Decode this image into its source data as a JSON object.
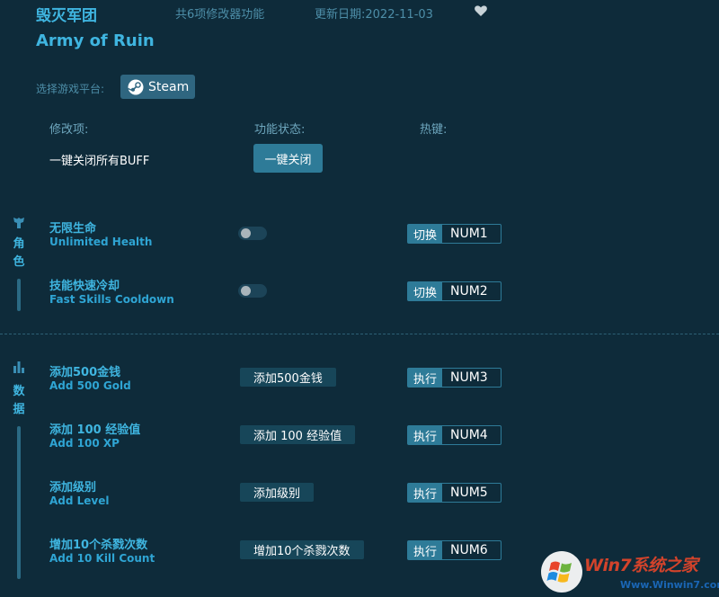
{
  "header": {
    "title_cn": "毁灭军团",
    "feature_count": "共6项修改器功能",
    "update_date": "更新日期:2022-11-03",
    "title_en": "Army of Ruin"
  },
  "platform": {
    "label": "选择游戏平台:",
    "button": "Steam"
  },
  "columns": {
    "mod": "修改项:",
    "status": "功能状态:",
    "hotkey": "热键:"
  },
  "global": {
    "label": "一键关闭所有BUFF",
    "button": "一键关闭"
  },
  "sections": {
    "character": {
      "line1": "角",
      "line2": "色"
    },
    "data": {
      "line1": "数",
      "line2": "据"
    }
  },
  "character_items": [
    {
      "cn": "无限生命",
      "en": "Unlimited Health",
      "toggle_on": false,
      "hk_type": "切换",
      "hk_key": "NUM1"
    },
    {
      "cn": "技能快速冷却",
      "en": "Fast Skills Cooldown",
      "toggle_on": false,
      "hk_type": "切换",
      "hk_key": "NUM2"
    }
  ],
  "data_items": [
    {
      "cn": "添加500金钱",
      "en": "Add 500 Gold",
      "button": "添加500金钱",
      "hk_type": "执行",
      "hk_key": "NUM3"
    },
    {
      "cn": "添加 100 经验值",
      "en": "Add 100 XP",
      "button": "添加 100 经验值",
      "hk_type": "执行",
      "hk_key": "NUM4"
    },
    {
      "cn": "添加级别",
      "en": "Add Level",
      "button": "添加级别",
      "hk_type": "执行",
      "hk_key": "NUM5"
    },
    {
      "cn": "增加10个杀戮次数",
      "en": "Add 10 Kill Count",
      "button": "增加10个杀戮次数",
      "hk_type": "执行",
      "hk_key": "NUM6"
    }
  ],
  "watermark": {
    "brand": "Win7系统之家",
    "url": "Www.Winwin7.com"
  },
  "colors": {
    "background": "#0e2b3a",
    "accent": "#3fb5e0",
    "button": "#2e7b98"
  }
}
